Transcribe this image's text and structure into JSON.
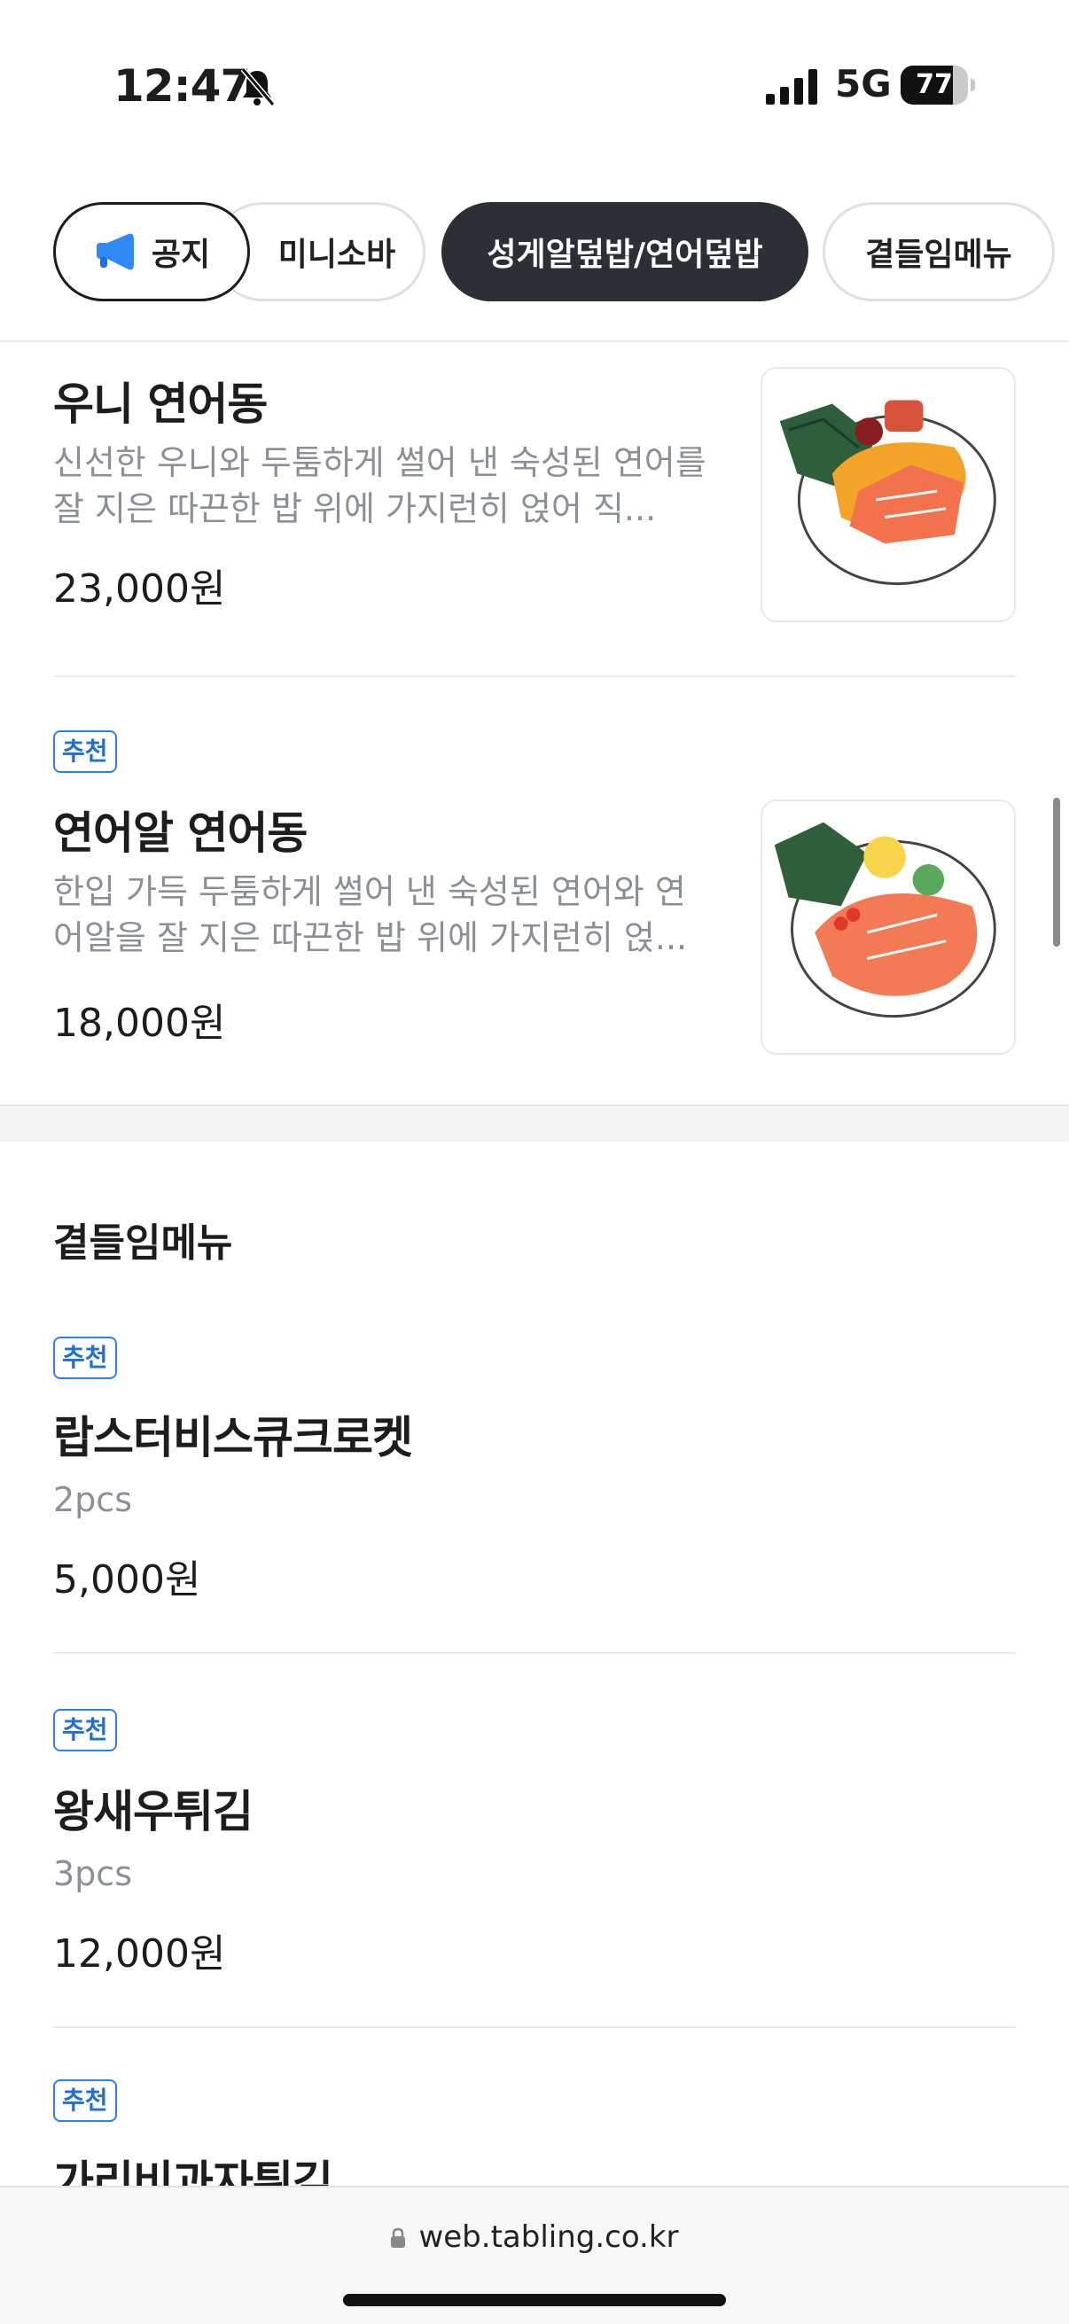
{
  "status_bar": {
    "time": "12:47",
    "network": "5G",
    "battery": "77",
    "battery_level": 0.77
  },
  "tabs": [
    {
      "label": "공지",
      "icon": "megaphone-icon"
    },
    {
      "label": "미니소바"
    },
    {
      "label": "성게알덮밥/연어덮밥",
      "active": true
    },
    {
      "label": "곁들임메뉴"
    }
  ],
  "items": [
    {
      "name": "우니 연어동",
      "badge": "",
      "description": "신선한 우니와 두툼하게 썰어 낸 숙성된 연어를 잘 지은 따끈한 밥 위에 가지런히 얹어 직...",
      "price": "23,000원",
      "image": "uni-salmon-bowl"
    },
    {
      "name": "연어알 연어동",
      "badge": "추천",
      "description": "한입 가득 두툼하게 썰어 낸 숙성된 연어와 연어알을 잘 지은 따끈한 밥 위에 가지런히 얹...",
      "price": "18,000원",
      "image": "salmon-roe-bowl"
    }
  ],
  "section": {
    "title": "곁들임메뉴",
    "items": [
      {
        "badge": "추천",
        "name": "랍스터비스큐크로켓",
        "qty": "2pcs",
        "price": "5,000원"
      },
      {
        "badge": "추천",
        "name": "왕새우튀김",
        "qty": "3pcs",
        "price": "12,000원"
      },
      {
        "badge": "추천",
        "name": "가리비과자튀김"
      }
    ]
  },
  "browser": {
    "url": "web.tabling.co.kr"
  },
  "colors": {
    "accent_blue": "#2f80ed",
    "active_chip": "#2b2f36",
    "muted_text": "#8b9096"
  }
}
